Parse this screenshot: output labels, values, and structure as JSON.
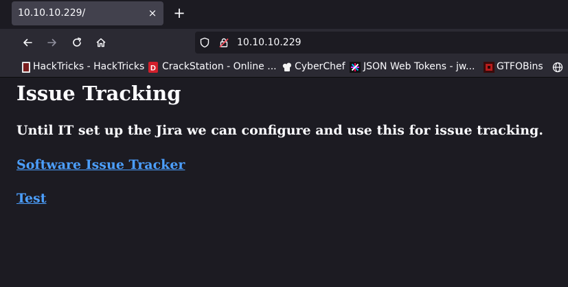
{
  "tab": {
    "title": "10.10.10.229/",
    "close_icon": "×",
    "new_tab_icon": "+"
  },
  "nav": {
    "url": "10.10.10.229"
  },
  "bookmarks": [
    {
      "label": "HackTricks - HackTricks",
      "icon": "hacktricks-icon"
    },
    {
      "label": "CrackStation - Online ...",
      "icon": "crackstation-icon"
    },
    {
      "label": "CyberChef",
      "icon": "cyberchef-icon"
    },
    {
      "label": "JSON Web Tokens - jw...",
      "icon": "jwt-icon"
    },
    {
      "label": "GTFOBins",
      "icon": "gtfobins-icon"
    }
  ],
  "page": {
    "heading": "Issue Tracking",
    "subheading": "Until IT set up the Jira we can configure and use this for issue tracking.",
    "links": [
      {
        "label": "Software Issue Tracker"
      },
      {
        "label": "Test"
      }
    ]
  },
  "colors": {
    "accent_link": "#4c9ffe",
    "background": "#1c1b22",
    "toolbar": "#2b2a33"
  }
}
